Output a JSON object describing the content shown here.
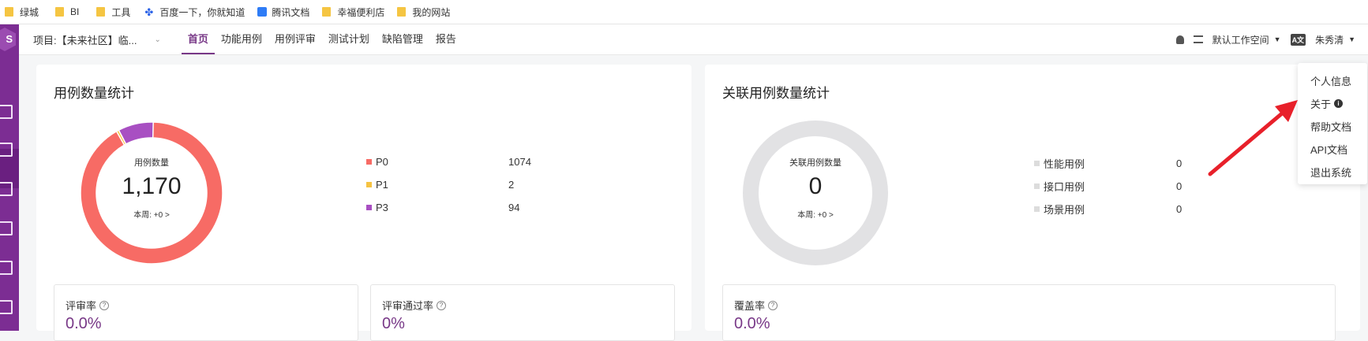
{
  "bookmarks": [
    {
      "label": "绿城",
      "icon": "folder-icon"
    },
    {
      "label": "BI",
      "icon": "folder-icon"
    },
    {
      "label": "工具",
      "icon": "folder-icon"
    },
    {
      "label": "百度一下，你就知道",
      "icon": "baidu-paw-icon"
    },
    {
      "label": "腾讯文档",
      "icon": "tencent-docs-icon"
    },
    {
      "label": "幸福便利店",
      "icon": "folder-icon"
    },
    {
      "label": "我的网站",
      "icon": "folder-icon"
    }
  ],
  "project": {
    "label": "项目:【未来社区】临..."
  },
  "tabs": [
    {
      "label": "首页",
      "active": true
    },
    {
      "label": "功能用例",
      "active": false
    },
    {
      "label": "用例评审",
      "active": false
    },
    {
      "label": "测试计划",
      "active": false
    },
    {
      "label": "缺陷管理",
      "active": false
    },
    {
      "label": "报告",
      "active": false
    }
  ],
  "nav_right": {
    "workspace": "默认工作空间",
    "lang_badge": "A文",
    "user": "朱秀清"
  },
  "case_stats": {
    "title": "用例数量统计",
    "center_label": "用例数量",
    "total": "1,170",
    "week": "本周: +0 >",
    "legend": [
      {
        "name": "P0",
        "value": "1074",
        "count": 1074,
        "color": "#f76b65"
      },
      {
        "name": "P1",
        "value": "2",
        "count": 2,
        "color": "#f6c342"
      },
      {
        "name": "P3",
        "value": "94",
        "count": 94,
        "color": "#a84fc2"
      }
    ]
  },
  "related_stats": {
    "title": "关联用例数量统计",
    "center_label": "关联用例数量",
    "total": "0",
    "week": "本周: +0 >",
    "legend": [
      {
        "name": "性能用例",
        "value": "0"
      },
      {
        "name": "接口用例",
        "value": "0"
      },
      {
        "name": "场景用例",
        "value": "0"
      }
    ],
    "ring_color": "#e2e2e4"
  },
  "rates": {
    "review_rate": {
      "label": "评审率",
      "value": "0.0%"
    },
    "review_pass_rate": {
      "label": "评审通过率",
      "value": "0%"
    },
    "coverage_rate": {
      "label": "覆盖率",
      "value": "0.0%"
    }
  },
  "user_menu": {
    "items": [
      "个人信息",
      "关于",
      "帮助文档",
      "API文档",
      "退出系统"
    ]
  },
  "colors": {
    "accent": "#783887",
    "arrow": "#e8202a"
  }
}
